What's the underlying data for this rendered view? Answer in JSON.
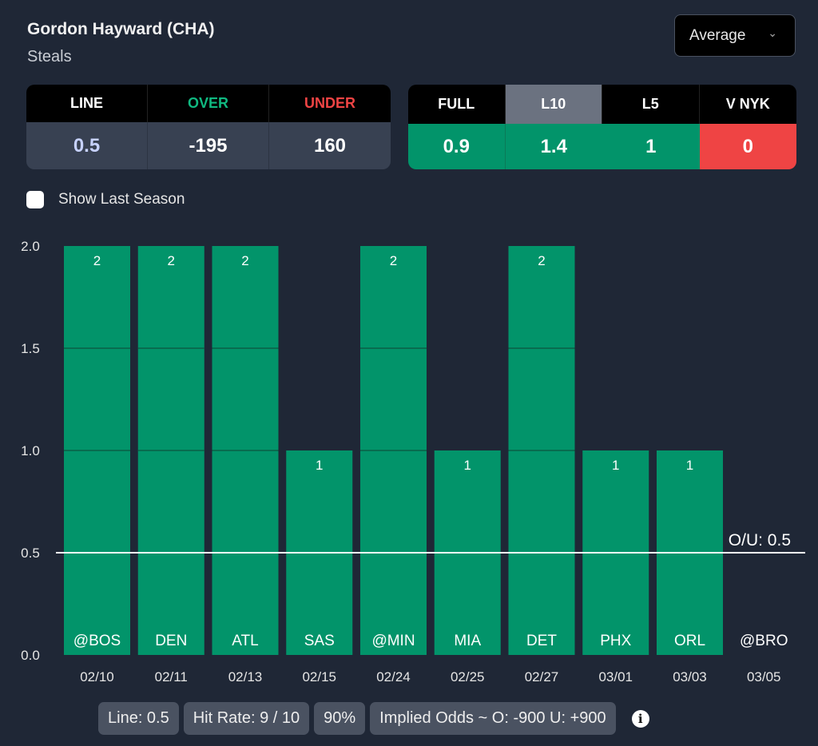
{
  "header": {
    "title": "Gordon Hayward (CHA)",
    "subtitle": "Steals"
  },
  "dropdown": {
    "selected": "Average",
    "icon": "chevron-down-icon"
  },
  "odds_table": {
    "headers": [
      {
        "label": "LINE",
        "color": "#ffffff"
      },
      {
        "label": "OVER",
        "color": "#10b981"
      },
      {
        "label": "UNDER",
        "color": "#ef4444"
      }
    ],
    "values": [
      {
        "value": "0.5",
        "color": "#c7d2fe"
      },
      {
        "value": "-195",
        "color": "#ffffff"
      },
      {
        "value": "160",
        "color": "#ffffff"
      }
    ]
  },
  "avg_table": {
    "tabs": [
      "FULL",
      "L10",
      "L5",
      "V NYK"
    ],
    "active_tab": "L10",
    "values": [
      "0.9",
      "1.4",
      "1",
      "0"
    ],
    "status": [
      "green",
      "green",
      "green",
      "red"
    ]
  },
  "show_last_season": {
    "label": "Show Last Season",
    "checked": false
  },
  "chart_data": {
    "type": "bar",
    "categories": [
      "02/10",
      "02/11",
      "02/13",
      "02/15",
      "02/24",
      "02/25",
      "02/27",
      "03/01",
      "03/03",
      "03/05"
    ],
    "opponents": [
      "@BOS",
      "DEN",
      "ATL",
      "SAS",
      "@MIN",
      "MIA",
      "DET",
      "PHX",
      "ORL",
      "@BRO"
    ],
    "values": [
      2,
      2,
      2,
      1,
      2,
      1,
      2,
      1,
      1,
      0
    ],
    "ylim": [
      0,
      2
    ],
    "yticks": [
      "0.0",
      "0.5",
      "1.0",
      "1.5",
      "2.0"
    ],
    "reference_line": {
      "value": 0.5,
      "label": "O/U: 0.5"
    },
    "bar_color": "#02946a",
    "grid": false
  },
  "summary": {
    "line": "Line: 0.5",
    "hit_rate": "Hit Rate: 9 / 10",
    "percent": "90%",
    "implied_odds": "Implied Odds ~ O: -900 U: +900",
    "info_icon": "info-icon"
  }
}
